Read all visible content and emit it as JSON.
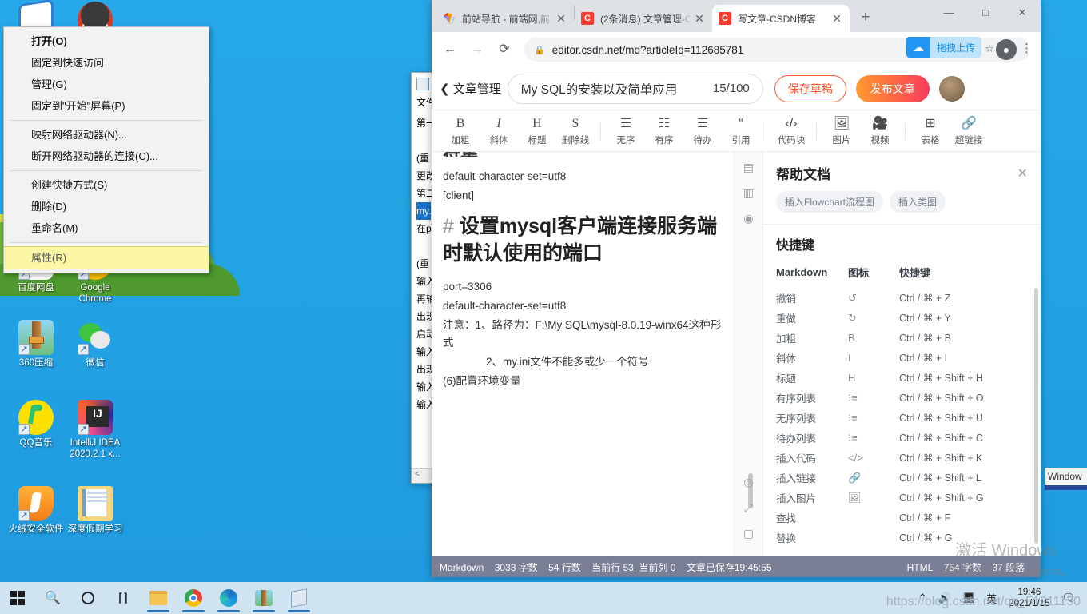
{
  "desktop": {
    "icons": [
      {
        "name": "baidu-netdisk",
        "label": "百度网盘"
      },
      {
        "name": "google-chrome",
        "label": "Google Chrome"
      },
      {
        "name": "360-zip",
        "label": "360压缩"
      },
      {
        "name": "wechat",
        "label": "微信"
      },
      {
        "name": "qq-music",
        "label": "QQ音乐"
      },
      {
        "name": "intellij-idea",
        "label": "IntelliJ IDEA 2020.2.1 x..."
      },
      {
        "name": "huorong-security",
        "label": "火绒安全软件"
      },
      {
        "name": "holiday-study-folder",
        "label": "深度假期学习"
      }
    ]
  },
  "context_menu": {
    "items": [
      {
        "label": "打开(O)",
        "bold": true,
        "separator_after": false
      },
      {
        "label": "固定到快速访问",
        "bold": false,
        "separator_after": false
      },
      {
        "label": "管理(G)",
        "bold": false,
        "separator_after": false
      },
      {
        "label": "固定到\"开始\"屏幕(P)",
        "bold": false,
        "separator_after": true
      },
      {
        "label": "映射网络驱动器(N)...",
        "bold": false,
        "separator_after": false
      },
      {
        "label": "断开网络驱动器的连接(C)...",
        "bold": false,
        "separator_after": true
      },
      {
        "label": "创建快捷方式(S)",
        "bold": false,
        "separator_after": false
      },
      {
        "label": "删除(D)",
        "bold": false,
        "separator_after": false
      },
      {
        "label": "重命名(M)",
        "bold": false,
        "separator_after": true
      }
    ],
    "highlighted_item": "属性(R)",
    "highlight_color": "#fbf7a5"
  },
  "notepad": {
    "menu": "文件",
    "lines": [
      {
        "text": "第一",
        "selected": false
      },
      {
        "text": "",
        "selected": false
      },
      {
        "text": " (重",
        "selected": false
      },
      {
        "text": "更改",
        "selected": false
      },
      {
        "text": "第二",
        "selected": false
      },
      {
        "text": "my.",
        "selected": true
      },
      {
        "text": "在p",
        "selected": false
      },
      {
        "text": "",
        "selected": false
      },
      {
        "text": " (重",
        "selected": false
      },
      {
        "text": "输入",
        "selected": false
      },
      {
        "text": "再输",
        "selected": false
      },
      {
        "text": "出现",
        "selected": false
      },
      {
        "text": "启动",
        "selected": false
      },
      {
        "text": "输入",
        "selected": false
      },
      {
        "text": "出现",
        "selected": false
      },
      {
        "text": "输入",
        "selected": false
      },
      {
        "text": "输入",
        "selected": false
      }
    ]
  },
  "browser": {
    "tabs": [
      {
        "title": "前站导航 - 前端网,前",
        "favicon": "comet-icon",
        "active": false
      },
      {
        "title": "(2条消息) 文章管理-C",
        "favicon": "csdn-icon",
        "active": false
      },
      {
        "title": "写文章-CSDN博客",
        "favicon": "csdn-icon",
        "active": true
      }
    ],
    "new_tab_label": "+",
    "window_controls": {
      "minimize": "—",
      "maximize": "□",
      "close": "✕"
    },
    "nav": {
      "back": "←",
      "forward": "→",
      "reload": "⟳"
    },
    "url": "editor.csdn.net/md?articleId=112685781",
    "lock_icon": "lock-icon",
    "extension": {
      "label": "拖拽上传",
      "icon": "baidu-cloud-icon"
    },
    "bookmark_star": "☆",
    "profile_icon": "profile-icon",
    "menu_icon": "kebab-menu-icon"
  },
  "editor": {
    "back_label": "文章管理",
    "title_value": "My SQL的安装以及简单应用",
    "title_count": "15/100",
    "save_draft_label": "保存草稿",
    "publish_label": "发布文章",
    "toolbar": [
      {
        "icon": "B",
        "label": "加粗",
        "name": "bold"
      },
      {
        "icon": "I",
        "label": "斜体",
        "name": "italic"
      },
      {
        "icon": "H",
        "label": "标题",
        "name": "heading"
      },
      {
        "icon": "S",
        "label": "删除线",
        "name": "strikethrough"
      },
      {
        "icon": "list-ul-icon",
        "label": "无序",
        "name": "unordered-list"
      },
      {
        "icon": "list-ol-icon",
        "label": "有序",
        "name": "ordered-list"
      },
      {
        "icon": "list-todo-icon",
        "label": "待办",
        "name": "todo-list"
      },
      {
        "icon": "quote-icon",
        "label": "引用",
        "name": "quote"
      },
      {
        "icon": "code-icon",
        "label": "代码块",
        "name": "code-block"
      },
      {
        "icon": "image-icon",
        "label": "图片",
        "name": "image"
      },
      {
        "icon": "video-icon",
        "label": "视频",
        "name": "video"
      },
      {
        "icon": "table-icon",
        "label": "表格",
        "name": "table"
      },
      {
        "icon": "link-icon",
        "label": "超链接",
        "name": "hyperlink"
      }
    ],
    "content": {
      "top_cut_text": "符集",
      "lines_before": [
        "default-character-set=utf8",
        "[client]"
      ],
      "heading_hash": "#",
      "heading": "设置mysql客户端连接服务端时默认使用的端口",
      "lines_after": [
        "port=3306",
        "default-character-set=utf8",
        "注意：1、路径为：F:\\My SQL\\mysql-8.0.19-winx64这种形式",
        "　　　　2、my.ini文件不能多或少一个符号",
        "(6)配置环境变量"
      ]
    },
    "rail_icons": [
      "panel-top-icon",
      "split-view-icon",
      "eye-preview-icon",
      "target-icon",
      "fullscreen-icon",
      "screen-icon"
    ],
    "status": {
      "left": [
        "Markdown",
        "3033 字数",
        "54 行数",
        "当前行 53, 当前列 0",
        "文章已保存19:45:55"
      ],
      "right": [
        "HTML",
        "754 字数",
        "37 段落"
      ]
    }
  },
  "help_panel": {
    "title": "帮助文档",
    "close_icon": "close-icon",
    "chips": [
      "插入Flowchart流程图",
      "插入类图"
    ],
    "section_title": "快捷键",
    "table_headers": [
      "Markdown",
      "图标",
      "快捷键"
    ],
    "rows": [
      {
        "md": "撤销",
        "icon": "↺",
        "key": "Ctrl / ⌘ + Z"
      },
      {
        "md": "重做",
        "icon": "↻",
        "key": "Ctrl / ⌘ + Y"
      },
      {
        "md": "加粗",
        "icon": "B",
        "key": "Ctrl / ⌘ + B"
      },
      {
        "md": "斜体",
        "icon": "I",
        "key": "Ctrl / ⌘ + I"
      },
      {
        "md": "标题",
        "icon": "H",
        "key": "Ctrl / ⌘ + Shift + H"
      },
      {
        "md": "有序列表",
        "icon": "⁝≡",
        "key": "Ctrl / ⌘ + Shift + O"
      },
      {
        "md": "无序列表",
        "icon": "⁝≡",
        "key": "Ctrl / ⌘ + Shift + U"
      },
      {
        "md": "待办列表",
        "icon": "⁝≡",
        "key": "Ctrl / ⌘ + Shift + C"
      },
      {
        "md": "插入代码",
        "icon": "</>",
        "key": "Ctrl / ⌘ + Shift + K"
      },
      {
        "md": "插入链接",
        "icon": "🔗",
        "key": "Ctrl / ⌘ + Shift + L"
      },
      {
        "md": "插入图片",
        "icon": "🖼",
        "key": "Ctrl / ⌘ + Shift + G"
      },
      {
        "md": "查找",
        "icon": "",
        "key": "Ctrl / ⌘ + F"
      },
      {
        "md": "替换",
        "icon": "",
        "key": "Ctrl / ⌘ + G"
      }
    ]
  },
  "windows_watermark": {
    "line1": "激活 Windows",
    "line2": "转到\"设置\"以激活 Windows。"
  },
  "background_window_tab": {
    "label": "Window"
  },
  "taskbar": {
    "items": [
      {
        "name": "start-button",
        "icon": "windows-logo-icon",
        "running": false
      },
      {
        "name": "search-button",
        "icon": "search-icon",
        "running": false
      },
      {
        "name": "cortana-button",
        "icon": "cortana-circle-icon",
        "running": false
      },
      {
        "name": "task-view-button",
        "icon": "task-view-icon",
        "running": false
      },
      {
        "name": "file-explorer",
        "icon": "folder-icon",
        "running": true
      },
      {
        "name": "chrome",
        "icon": "chrome-icon",
        "running": true
      },
      {
        "name": "edge",
        "icon": "edge-icon",
        "running": true
      },
      {
        "name": "360-zip",
        "icon": "zip-icon",
        "running": true
      },
      {
        "name": "notepad",
        "icon": "notepad-icon",
        "running": true
      }
    ],
    "tray": {
      "chevron": "⌃",
      "volume": "🔊",
      "network": "network-icon",
      "ime": "英",
      "time": "19:46",
      "date": "2021/1/15",
      "notifications": "💬"
    }
  },
  "overlay_watermark": "https://blog.csdn.net/qq_51211150"
}
